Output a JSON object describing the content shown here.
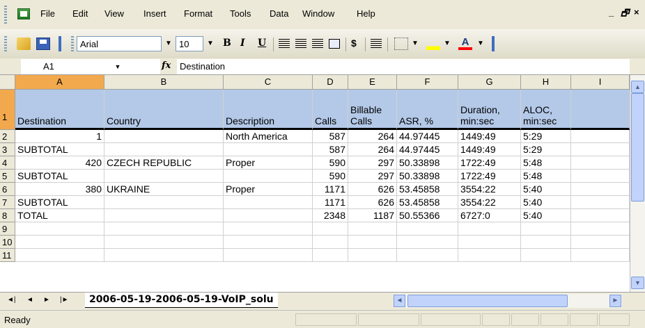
{
  "menu": [
    "File",
    "Edit",
    "View",
    "Insert",
    "Format",
    "Tools",
    "Data",
    "Window",
    "Help"
  ],
  "menu_mnemonic": [
    "F",
    "E",
    "V",
    "I",
    "o",
    "T",
    "D",
    "W",
    "H"
  ],
  "window_controls": {
    "minimize": "_",
    "restore": "ȩ",
    "close": "×"
  },
  "toolbar": {
    "font_name": "Arial",
    "font_size": "10",
    "bold": "B",
    "italic": "I",
    "underline": "U",
    "currency": "$"
  },
  "formula_bar": {
    "cell_ref": "A1",
    "fx": "fx",
    "content": "Destination"
  },
  "columns": [
    "A",
    "B",
    "C",
    "D",
    "E",
    "F",
    "G",
    "H",
    "I"
  ],
  "rows": [
    {
      "num": "1",
      "cells": [
        "Destination",
        "Country",
        "Description",
        "Calls",
        "Billable Calls",
        "ASR, %",
        "Duration, min:sec",
        "ALOC, min:sec"
      ]
    },
    {
      "num": "2",
      "cells": [
        "1",
        "",
        "North America",
        "587",
        "264",
        "44.97445",
        "1449:49",
        "5:29"
      ]
    },
    {
      "num": "3",
      "cells": [
        "SUBTOTAL",
        "",
        "",
        "587",
        "264",
        "44.97445",
        "1449:49",
        "5:29"
      ]
    },
    {
      "num": "4",
      "cells": [
        "420",
        "CZECH REPUBLIC",
        "Proper",
        "590",
        "297",
        "50.33898",
        "1722:49",
        "5:48"
      ]
    },
    {
      "num": "5",
      "cells": [
        "SUBTOTAL",
        "",
        "",
        "590",
        "297",
        "50.33898",
        "1722:49",
        "5:48"
      ]
    },
    {
      "num": "6",
      "cells": [
        "380",
        "UKRAINE",
        "Proper",
        "1171",
        "626",
        "53.45858",
        "3554:22",
        "5:40"
      ]
    },
    {
      "num": "7",
      "cells": [
        "SUBTOTAL",
        "",
        "",
        "1171",
        "626",
        "53.45858",
        "3554:22",
        "5:40"
      ]
    },
    {
      "num": "8",
      "cells": [
        "TOTAL",
        "",
        "",
        "2348",
        "1187",
        "50.55366",
        "6727:0",
        "5:40"
      ]
    },
    {
      "num": "9",
      "cells": [
        "",
        "",
        "",
        "",
        "",
        "",
        "",
        ""
      ]
    },
    {
      "num": "10",
      "cells": [
        "",
        "",
        "",
        "",
        "",
        "",
        "",
        ""
      ]
    },
    {
      "num": "11",
      "cells": [
        "",
        "",
        "",
        "",
        "",
        "",
        "",
        ""
      ]
    }
  ],
  "sheet_tab": "2006-05-19-2006-05-19-VoIP_solu",
  "status": "Ready",
  "colors": {
    "selected_header": "#f2a94d",
    "header_row_fill": "#b4c9e8",
    "chrome": "#ece9d8"
  }
}
